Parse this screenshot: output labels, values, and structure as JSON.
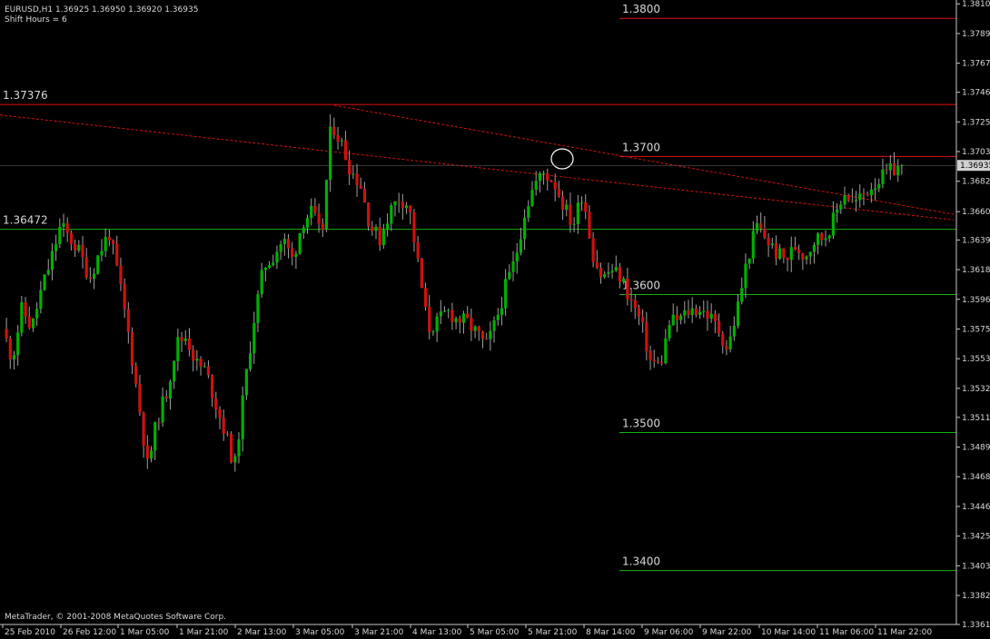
{
  "header": {
    "symbol_line": "EURUSD,H1  1.36925 1.36950 1.36920 1.36935",
    "shift_line": "Shift Hours = 6"
  },
  "copyright": "MetaTrader, © 2001-2008 MetaQuotes Software Corp.",
  "colors": {
    "background": "#000000",
    "axis": "#c8c8c8",
    "bull_candle": "#00b000",
    "bear_candle": "#d01010",
    "wick": "#a0a0a0",
    "resistance": "#e01010",
    "support": "#10b010",
    "trendline": "#d01010",
    "current_price_label_bg": "#d0d0d0"
  },
  "chart_data": {
    "type": "candlestick",
    "symbol": "EURUSD",
    "timeframe": "H1",
    "ylim": [
      1.3361,
      1.381
    ],
    "y_ticks": [
      "1.38105",
      "1.37890",
      "1.37675",
      "1.37465",
      "1.37250",
      "1.37035",
      "1.36820",
      "1.36600",
      "1.36395",
      "1.36180",
      "1.35965",
      "1.35750",
      "1.35535",
      "1.35320",
      "1.35110",
      "1.34895",
      "1.34680",
      "1.34465",
      "1.34250",
      "1.34035",
      "1.33820",
      "1.33610"
    ],
    "current_price": "1.36935",
    "x_ticks": [
      "25 Feb 2010",
      "26 Feb 12:00",
      "1 Mar 05:00",
      "1 Mar 21:00",
      "2 Mar 13:00",
      "3 Mar 05:00",
      "3 Mar 21:00",
      "4 Mar 13:00",
      "5 Mar 05:00",
      "5 Mar 21:00",
      "8 Mar 14:00",
      "9 Mar 06:00",
      "9 Mar 22:00",
      "10 Mar 14:00",
      "11 Mar 06:00",
      "11 Mar 22:00"
    ],
    "horizontal_levels": [
      {
        "label": "1.37376",
        "value": 1.37376,
        "color": "red",
        "span": "full"
      },
      {
        "label": "1.3800",
        "value": 1.38,
        "color": "red",
        "span": "partial"
      },
      {
        "label": "1.3700",
        "value": 1.37,
        "color": "red",
        "span": "partial"
      },
      {
        "label": "1.36472",
        "value": 1.36472,
        "color": "green",
        "span": "full"
      },
      {
        "label": "1.3600",
        "value": 1.36,
        "color": "green",
        "span": "partial"
      },
      {
        "label": "1.3500",
        "value": 1.35,
        "color": "green",
        "span": "partial"
      },
      {
        "label": "1.3400",
        "value": 1.34,
        "color": "green",
        "span": "partial"
      }
    ],
    "trendlines": [
      {
        "style": "dashed",
        "start_value": 1.373,
        "end_value": 1.3654
      },
      {
        "style": "dashed",
        "start_value": 1.3737,
        "end_value": 1.3658
      }
    ],
    "close_path": [
      1.3575,
      1.3553,
      1.359,
      1.3575,
      1.3603,
      1.3625,
      1.365,
      1.364,
      1.363,
      1.3612,
      1.363,
      1.3645,
      1.3612,
      1.3572,
      1.3525,
      1.3475,
      1.351,
      1.353,
      1.3565,
      1.357,
      1.355,
      1.3545,
      1.3522,
      1.35,
      1.3475,
      1.3532,
      1.3582,
      1.362,
      1.3628,
      1.364,
      1.3625,
      1.3653,
      1.366,
      1.364,
      1.3725,
      1.371,
      1.369,
      1.368,
      1.365,
      1.364,
      1.366,
      1.367,
      1.3665,
      1.362,
      1.3575,
      1.358,
      1.3588,
      1.3582,
      1.358,
      1.3572,
      1.3562,
      1.358,
      1.3605,
      1.3625,
      1.366,
      1.368,
      1.3688,
      1.3682,
      1.3665,
      1.365,
      1.3675,
      1.363,
      1.3612,
      1.3618,
      1.3612,
      1.3595,
      1.358,
      1.3552,
      1.3548,
      1.358,
      1.3582,
      1.3588,
      1.359,
      1.3585,
      1.3575,
      1.356,
      1.359,
      1.3625,
      1.365,
      1.364,
      1.363,
      1.3625,
      1.3635,
      1.3628,
      1.364,
      1.3642,
      1.3655,
      1.3675,
      1.3665,
      1.3672,
      1.368,
      1.3685,
      1.369,
      1.36935
    ]
  }
}
